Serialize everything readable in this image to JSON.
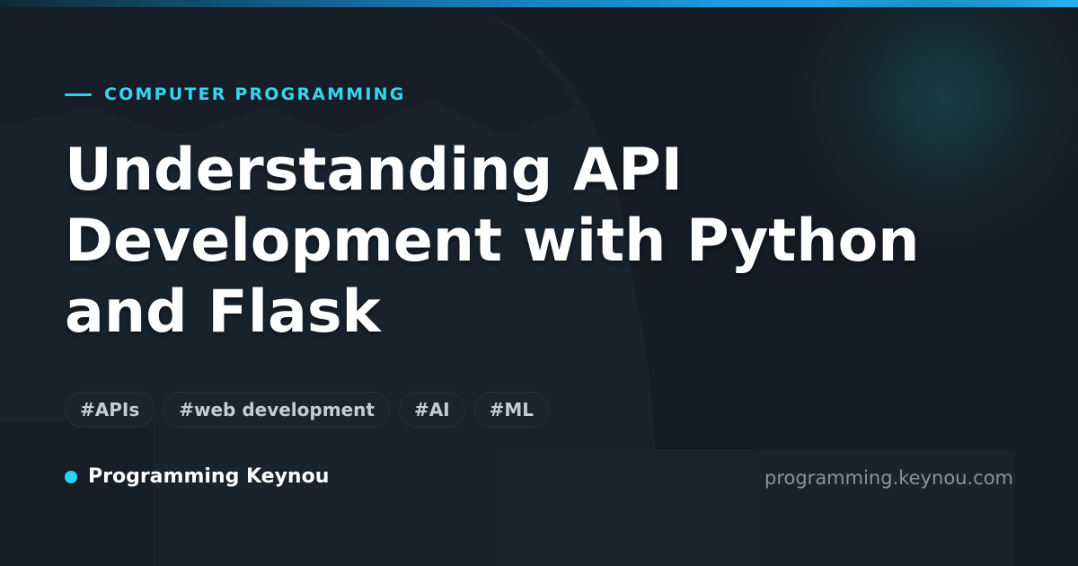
{
  "header": {
    "category": "COMPUTER PROGRAMMING",
    "title": "Understanding API Development with Python and Flask"
  },
  "tags": [
    "#APIs",
    "#web development",
    "#AI",
    "#ML"
  ],
  "footer": {
    "brand_name": "Programming Keynou",
    "site_url": "programming.keynou.com"
  },
  "colors": {
    "accent": "#2ad4f2",
    "background": "#161c25",
    "title_text": "#ffffff",
    "tag_text": "#c6ccd6",
    "url_text": "#8a929e"
  },
  "icons": {
    "category_marker": "accent-line-icon",
    "brand_marker": "dot-icon"
  }
}
